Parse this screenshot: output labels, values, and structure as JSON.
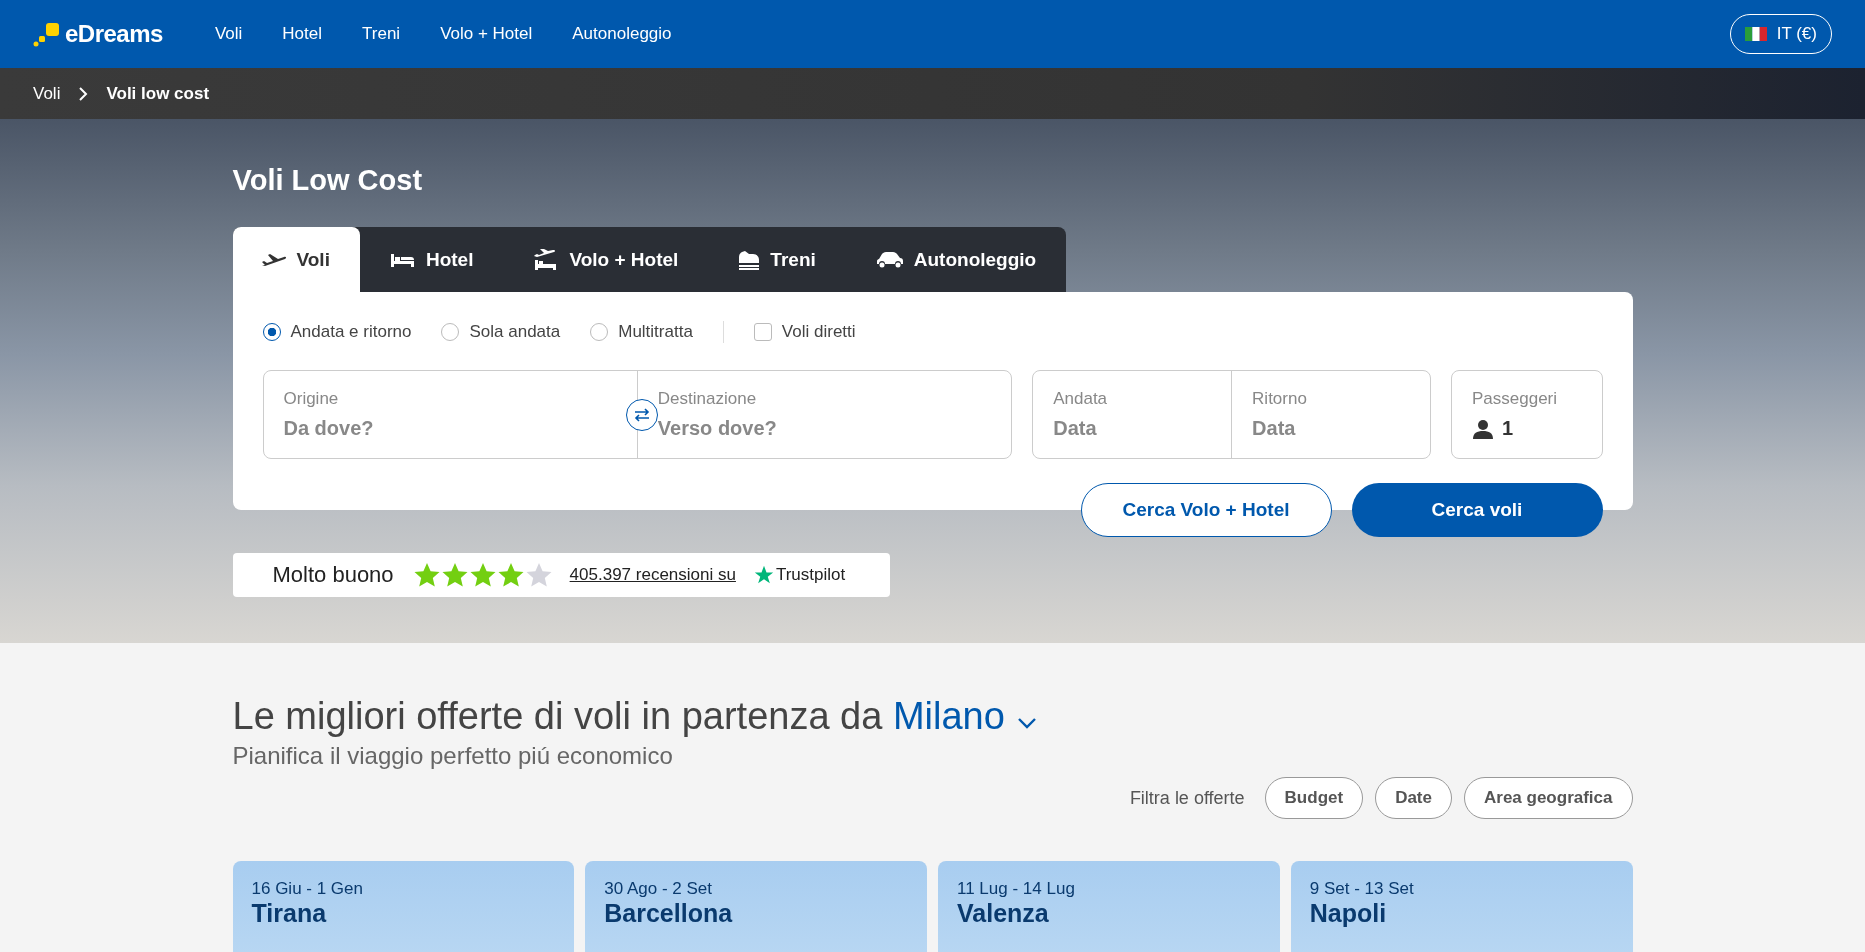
{
  "header": {
    "logo": "eDreams",
    "nav": [
      "Voli",
      "Hotel",
      "Treni",
      "Volo + Hotel",
      "Autonoleggio"
    ],
    "language": "IT (€)"
  },
  "breadcrumb": [
    "Voli",
    "Voli low cost"
  ],
  "hero": {
    "title": "Voli Low Cost"
  },
  "tabs": [
    {
      "kind": "flight",
      "label": "Voli",
      "selected": true
    },
    {
      "kind": "hotel",
      "label": "Hotel",
      "selected": false
    },
    {
      "kind": "package",
      "label": "Volo + Hotel",
      "selected": false
    },
    {
      "kind": "train",
      "label": "Treni",
      "selected": false
    },
    {
      "kind": "car",
      "label": "Autonoleggio",
      "selected": false
    }
  ],
  "trip_types": [
    {
      "label": "Andata e ritorno",
      "selected": true
    },
    {
      "label": "Sola andata",
      "selected": false
    },
    {
      "label": "Multitratta",
      "selected": false
    }
  ],
  "direct_flights": {
    "label": "Voli diretti",
    "checked": false
  },
  "fields": {
    "origin": {
      "label": "Origine",
      "placeholder": "Da dove?"
    },
    "destination": {
      "label": "Destinazione",
      "placeholder": "Verso dove?"
    },
    "departure": {
      "label": "Andata",
      "placeholder": "Data"
    },
    "return": {
      "label": "Ritorno",
      "placeholder": "Data"
    },
    "passengers": {
      "label": "Passeggeri",
      "value": "1"
    }
  },
  "buttons": {
    "secondary": "Cerca Volo + Hotel",
    "primary": "Cerca voli"
  },
  "rating": {
    "label": "Molto buono",
    "stars": 4,
    "reviews": "405.397 recensioni su",
    "brand": "Trustpilot"
  },
  "offers": {
    "title": "Le migliori offerte di voli in partenza da",
    "city": "Milano",
    "subtitle": "Pianifica il viaggio perfetto piú economico",
    "filter_label": "Filtra le offerte",
    "filters": [
      "Budget",
      "Date",
      "Area geografica"
    ],
    "cards": [
      {
        "dates": "16 Giu - 1 Gen",
        "city": "Tirana"
      },
      {
        "dates": "30 Ago - 2 Set",
        "city": "Barcellona"
      },
      {
        "dates": "11 Lug - 14 Lug",
        "city": "Valenza"
      },
      {
        "dates": "9 Set - 13 Set",
        "city": "Napoli"
      }
    ]
  }
}
